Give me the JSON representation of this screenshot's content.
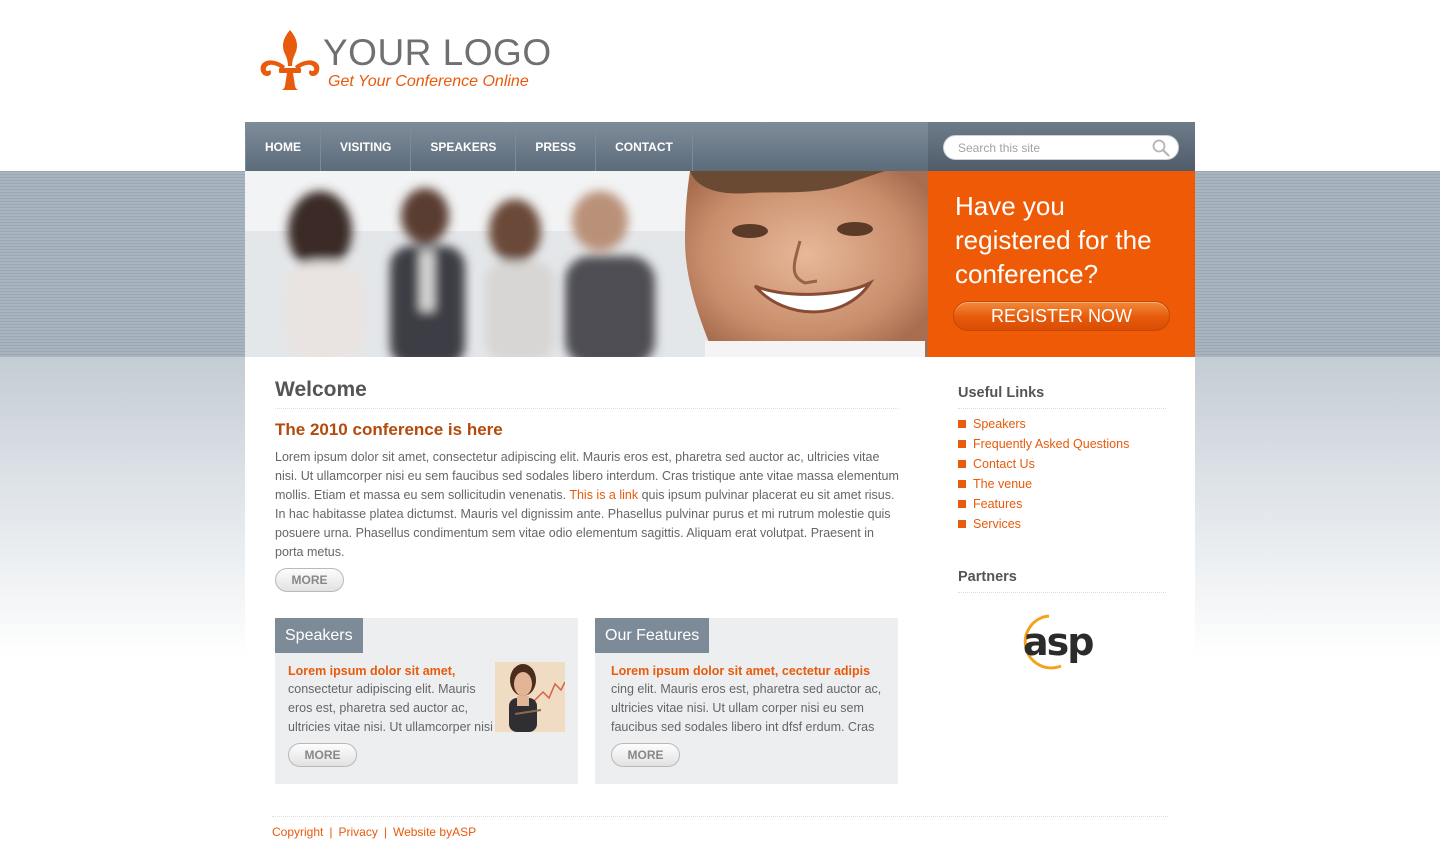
{
  "brand": {
    "logo_text": "YOUR LOGO",
    "tagline": "Get Your Conference Online",
    "accent_color": "#ee5a06",
    "logo_icon": "fleur-de-lis-icon"
  },
  "nav": {
    "items": [
      "HOME",
      "VISITING",
      "SPEAKERS",
      "PRESS",
      "CONTACT"
    ]
  },
  "search": {
    "placeholder": "Search this site",
    "icon": "search-icon"
  },
  "register": {
    "text": "Have you registered for the conference?",
    "button": "REGISTER NOW"
  },
  "main": {
    "title": "Welcome",
    "subtitle": "The 2010 conference is here",
    "intro_before_link": "Lorem ipsum dolor sit amet, consectetur adipiscing elit. Mauris eros est, pharetra sed auctor ac, ultricies vitae nisi. Ut ullamcorper nisi eu sem faucibus sed sodales libero interdum. Cras tristique ante vitae massa elementum mollis. Etiam et massa eu sem sollicitudin venenatis. ",
    "intro_link": "This is a link",
    "intro_after_link": " quis ipsum pulvinar placerat eu sit amet risus. In hac habitasse platea dictumst. Mauris vel dignissim ante. Phasellus pulvinar purus et mi rutrum molestie quis posuere urna. Phasellus condimentum sem vitae odio elementum sagittis. Aliquam erat volutpat. Praesent in porta metus.",
    "more": "MORE"
  },
  "cards": [
    {
      "tab": "Speakers",
      "heading": "Lorem ipsum dolor sit amet,",
      "lines": [
        "consectetur adipiscing elit. Mauris",
        "eros est, pharetra sed auctor ac,",
        "ultricies vitae nisi. Ut ullamcorper nisi"
      ],
      "more": "MORE"
    },
    {
      "tab": "Our Features",
      "heading": "Lorem ipsum dolor sit amet, cectetur adipis",
      "lines": [
        "cing elit. Mauris eros est, pharetra sed auctor ac,",
        "ultricies vitae nisi. Ut ullam corper nisi eu sem",
        "faucibus sed sodales libero int dfsf erdum. Cras"
      ],
      "more": "MORE"
    }
  ],
  "sidebar": {
    "links_title": "Useful Links",
    "links": [
      "Speakers",
      "Frequently Asked Questions",
      "Contact Us",
      "The venue",
      "Features",
      "Services"
    ],
    "partners_title": "Partners",
    "partner_logo_text": "asp"
  },
  "footer": {
    "links": [
      "Copyright",
      "Privacy",
      "Website byASP"
    ],
    "separator": "|"
  }
}
